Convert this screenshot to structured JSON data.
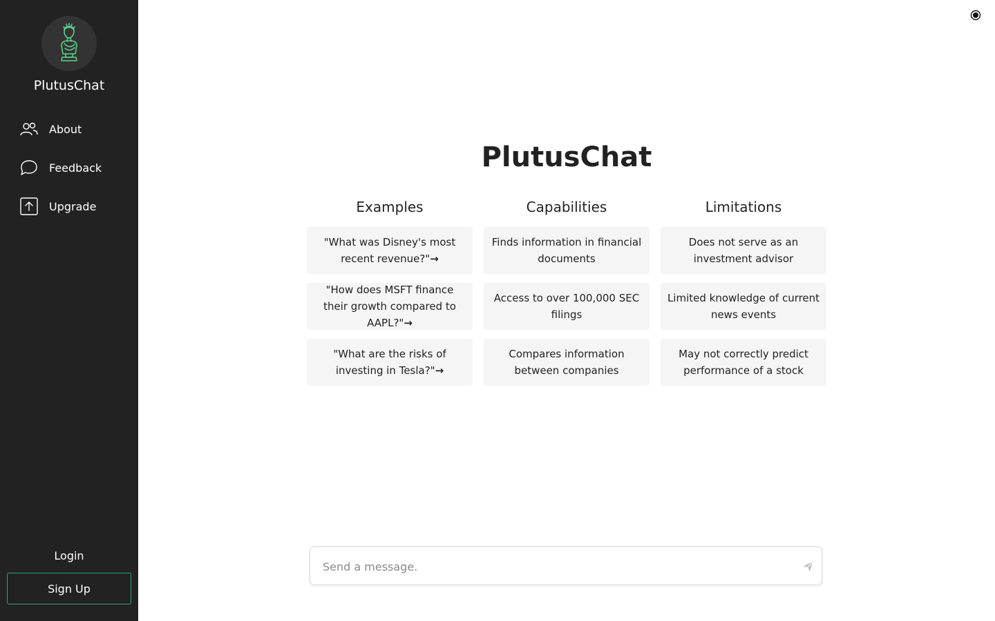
{
  "sidebar": {
    "brand": "PlutusChat",
    "logo_icon": "statue-bust-icon",
    "items": [
      {
        "label": "About",
        "icon": "users-icon"
      },
      {
        "label": "Feedback",
        "icon": "chat-bubble-icon"
      },
      {
        "label": "Upgrade",
        "icon": "upload-box-icon"
      }
    ],
    "login_label": "Login",
    "signup_label": "Sign Up"
  },
  "header": {
    "theme_toggle_icon": "theme-toggle-icon"
  },
  "main": {
    "title": "PlutusChat",
    "columns": [
      {
        "title": "Examples",
        "cards": [
          "\"What was Disney's most recent revenue?\"",
          "\"How does MSFT finance their growth compared to AAPL?\"",
          "\"What are the risks of investing in Tesla?\""
        ]
      },
      {
        "title": "Capabilities",
        "cards": [
          "Finds information in financial documents",
          "Access to over 100,000 SEC filings",
          "Compares information between companies"
        ]
      },
      {
        "title": "Limitations",
        "cards": [
          "Does not serve as an investment advisor",
          "Limited knowledge of current news events",
          "May not correctly predict performance of a stock"
        ]
      }
    ]
  },
  "composer": {
    "placeholder": "Send a message.",
    "value": ""
  },
  "colors": {
    "sidebar_bg": "#222222",
    "accent": "#2fa37a",
    "card_bg": "#f5f5f5"
  }
}
